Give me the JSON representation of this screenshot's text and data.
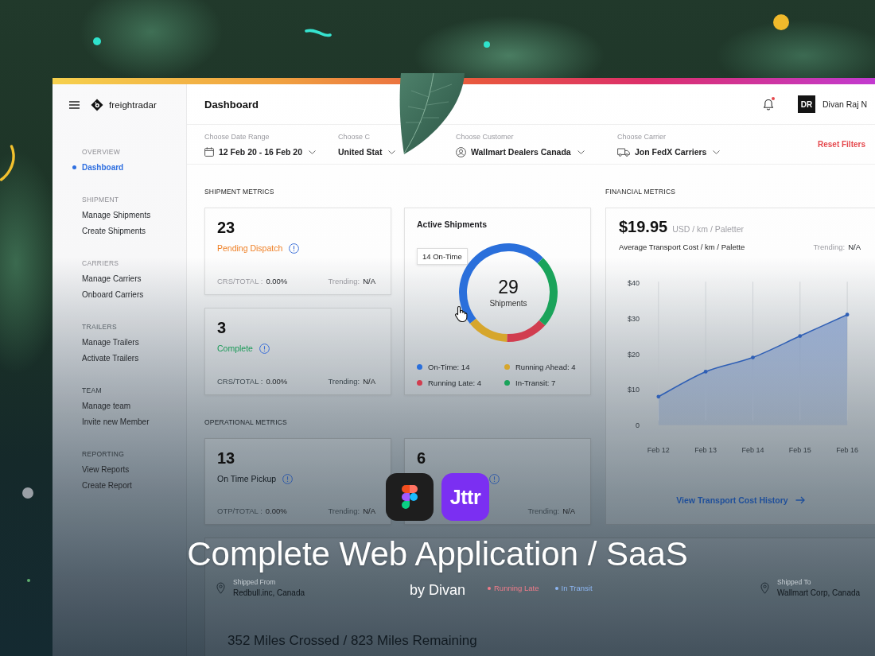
{
  "sidebar": {
    "brand": "freightradar",
    "groups": [
      {
        "title": "OVERVIEW",
        "items": [
          {
            "label": "Dashboard",
            "selected": true
          }
        ]
      },
      {
        "title": "SHIPMENT",
        "items": [
          {
            "label": "Manage Shipments",
            "selected": false
          },
          {
            "label": "Create Shipments",
            "selected": false
          }
        ]
      },
      {
        "title": "CARRIERS",
        "items": [
          {
            "label": "Manage Carriers",
            "selected": false
          },
          {
            "label": "Onboard Carriers",
            "selected": false
          }
        ]
      },
      {
        "title": "TRAILERS",
        "items": [
          {
            "label": "Manage Trailers",
            "selected": false
          },
          {
            "label": "Activate Trailers",
            "selected": false
          }
        ]
      },
      {
        "title": "TEAM",
        "items": [
          {
            "label": "Manage team",
            "selected": false
          },
          {
            "label": "Invite new Member",
            "selected": false
          }
        ]
      },
      {
        "title": "REPORTING",
        "items": [
          {
            "label": "View Reports",
            "selected": false
          },
          {
            "label": "Create Report",
            "selected": false
          }
        ]
      }
    ]
  },
  "header": {
    "title": "Dashboard",
    "unread_notifications": true,
    "user": {
      "initials": "DR",
      "name": "Divan Raj N"
    }
  },
  "filters": {
    "items": [
      {
        "kind": "date",
        "label": "Choose Date Range",
        "value": "12 Feb 20 - 16 Feb 20"
      },
      {
        "kind": "country",
        "label": "Choose C",
        "value": "United Stat"
      },
      {
        "kind": "customer",
        "label": "Choose Customer",
        "value": "Wallmart Dealers Canada"
      },
      {
        "kind": "carrier",
        "label": "Choose Carrier",
        "value": "Jon FedX Carriers"
      }
    ],
    "reset": "Reset Filters"
  },
  "shipment_metrics": {
    "title": "SHIPMENT METRICS",
    "cards": [
      {
        "color": "#ef7f24",
        "count": "23",
        "label": "Pending Dispatch",
        "ratio_label": "CRS/TOTAL :",
        "ratio_value": "0.00%",
        "trend_label": "Trending:",
        "trend_value": "N/A"
      },
      {
        "color": "#1b9a58",
        "count": "3",
        "label": "Complete",
        "ratio_label": "CRS/TOTAL :",
        "ratio_value": "0.00%",
        "trend_label": "Trending:",
        "trend_value": "N/A"
      }
    ],
    "active": {
      "title": "Active Shipments",
      "total": "29",
      "total_label": "Shipments",
      "tooltip": "14 On-Time",
      "chart_data": {
        "type": "donut",
        "series": [
          {
            "values": [
              48.3,
              13.8,
              13.8,
              24.1
            ]
          }
        ]
      },
      "legend": [
        {
          "label": "On-Time: 14",
          "color": "#2a6fdb"
        },
        {
          "label": "Running Ahead: 4",
          "color": "#d6a62c"
        },
        {
          "label": "Running Late: 4",
          "color": "#d13d4f"
        },
        {
          "label": "In-Transit: 7",
          "color": "#1aa35a"
        }
      ]
    }
  },
  "financial_metrics": {
    "title": "FINANCIAL METRICS",
    "amount": "$19.95",
    "unit": "USD / km / Paletter",
    "caption": "Average Transport Cost / km / Palette",
    "trend_label": "Trending:",
    "trend_value": "N/A",
    "chart_data": {
      "type": "area",
      "grid": true,
      "x": [
        "Feb 12",
        "Feb 13",
        "Feb 14",
        "Feb 15",
        "Feb 16"
      ],
      "series": [
        {
          "color": "#2f5fb5",
          "values": [
            8,
            15,
            19,
            25,
            31
          ]
        }
      ],
      "ylim": [
        0,
        40
      ],
      "yticks": [
        {
          "value": 0,
          "label": "0"
        },
        {
          "value": 10,
          "label": "$10"
        },
        {
          "value": 20,
          "label": "$20"
        },
        {
          "value": 30,
          "label": "$30"
        },
        {
          "value": 40,
          "label": "$40"
        }
      ]
    },
    "link": "View Transport Cost History"
  },
  "operational_metrics": {
    "title": "OPERATIONAL METRICS",
    "cards": [
      {
        "color": "#141c22",
        "count": "13",
        "label": "On Time Pickup",
        "ratio_label": "OTP/TOTAL :",
        "ratio_value": "0.00%",
        "trend_label": "Trending:",
        "trend_value": "N/A"
      },
      {
        "count": "6",
        "trend_label": "Trending:",
        "trend_value": "N/A"
      }
    ]
  },
  "shipment_route": {
    "origin_label": "Shipped From",
    "origin": "Redbull.inc, Canada",
    "statuses": [
      {
        "label": "Running Late",
        "color": "#f07c8a"
      },
      {
        "label": "In Transit",
        "color": "#8db6f2"
      }
    ],
    "destination_label": "Shipped To",
    "destination": "Wallmart Corp, Canada",
    "progress": "352 Miles Crossed / 823 Miles Remaining"
  },
  "promo": {
    "title": "Complete Web Application / SaaS",
    "byline": "by Divan",
    "badge": "Jttr"
  }
}
